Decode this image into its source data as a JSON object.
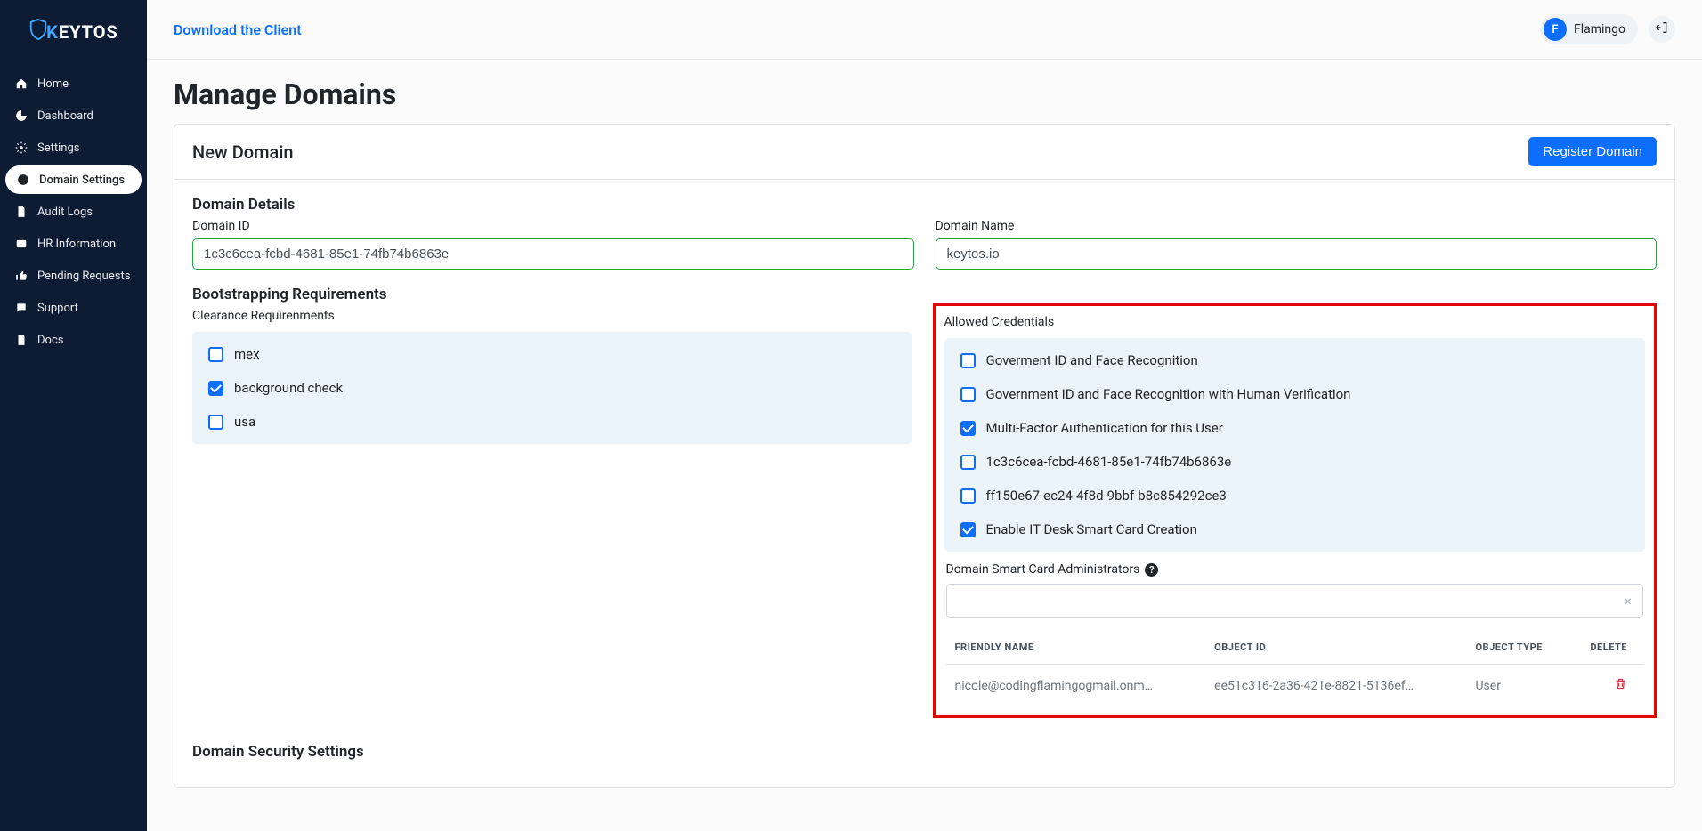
{
  "brand": {
    "part1": "K",
    "part2": "EY",
    "part3": "TOS"
  },
  "sidebar": {
    "items": [
      {
        "label": "Home",
        "icon": "home-icon"
      },
      {
        "label": "Dashboard",
        "icon": "dashboard-icon"
      },
      {
        "label": "Settings",
        "icon": "gear-icon"
      },
      {
        "label": "Domain Settings",
        "icon": "globe-icon",
        "active": true
      },
      {
        "label": "Audit Logs",
        "icon": "file-lock-icon"
      },
      {
        "label": "HR Information",
        "icon": "id-card-icon"
      },
      {
        "label": "Pending Requests",
        "icon": "thumbs-up-icon"
      },
      {
        "label": "Support",
        "icon": "chat-icon"
      },
      {
        "label": "Docs",
        "icon": "document-icon"
      }
    ]
  },
  "topbar": {
    "download_link": "Download the Client",
    "user_initial": "F",
    "user_name": "Flamingo"
  },
  "page": {
    "title": "Manage Domains",
    "new_domain_title": "New Domain",
    "register_button": "Register Domain",
    "domain_details_title": "Domain Details",
    "domain_id_label": "Domain ID",
    "domain_id_value": "1c3c6cea-fcbd-4681-85e1-74fb74b6863e",
    "domain_name_label": "Domain Name",
    "domain_name_value": "keytos.io",
    "bootstrap_title": "Bootstrapping Requirements",
    "clearance_label": "Clearance Requirenments",
    "clearance_items": [
      {
        "label": "mex",
        "checked": false
      },
      {
        "label": "background check",
        "checked": true
      },
      {
        "label": "usa",
        "checked": false
      }
    ],
    "allowed_label": "Allowed Credentials",
    "allowed_items": [
      {
        "label": "Goverment ID and Face Recognition",
        "checked": false
      },
      {
        "label": "Government ID and Face Recognition with Human Verification",
        "checked": false
      },
      {
        "label": "Multi-Factor Authentication for this User",
        "checked": true
      },
      {
        "label": "1c3c6cea-fcbd-4681-85e1-74fb74b6863e",
        "checked": false
      },
      {
        "label": "ff150e67-ec24-4f8d-9bbf-b8c854292ce3",
        "checked": false
      },
      {
        "label": "Enable IT Desk Smart Card Creation",
        "checked": true
      }
    ],
    "admins_label": "Domain Smart Card Administrators",
    "table_headers": [
      "FRIENDLY NAME",
      "OBJECT ID",
      "OBJECT TYPE",
      "DELETE"
    ],
    "table_rows": [
      {
        "friendly_name": "nicole@codingflamingogmail.onm…",
        "object_id": "ee51c316-2a36-421e-8821-5136ef…",
        "object_type": "User"
      }
    ],
    "security_title": "Domain Security Settings"
  }
}
